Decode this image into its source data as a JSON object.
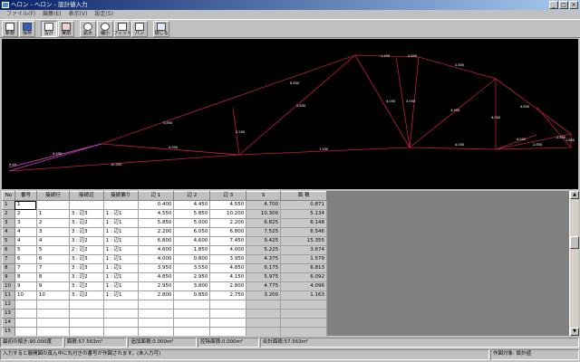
{
  "window": {
    "title": "ヘロン - ヘロン - 設計値入力",
    "min_label": "_",
    "max_label": "□",
    "close_label": "×"
  },
  "menu": [
    "ファイル(F)",
    "編集(E)",
    "表示(V)",
    "設定(S)"
  ],
  "toolbar": [
    {
      "label": "新規",
      "icon": "new-file-icon"
    },
    {
      "label": "保存",
      "icon": "save-icon"
    },
    {
      "label": "設計",
      "icon": "design-icon",
      "pressed": true
    },
    {
      "label": "実測",
      "icon": "measure-icon"
    },
    {
      "label": "拡大",
      "icon": "zoom-in-icon"
    },
    {
      "label": "縮小",
      "icon": "zoom-out-icon"
    },
    {
      "label": "フィット",
      "icon": "fit-icon"
    },
    {
      "label": "パン",
      "icon": "pan-icon"
    },
    {
      "label": "閉じる",
      "icon": "close-window-icon"
    }
  ],
  "drawing": {
    "edge_labels": [
      "1.450",
      "0.850",
      "2.800",
      "6.850",
      "4.050",
      "3.550",
      "5.850",
      "3.950",
      "5.850",
      "4.000",
      "2.200",
      "4.850",
      "4.000",
      "2.850",
      "7.450",
      "10.200",
      "4.950",
      "4.000",
      "2.800",
      "1.850",
      "0.40",
      "4.550"
    ]
  },
  "grid": {
    "headers": [
      "No",
      "番号",
      "接続行",
      "接続辺",
      "接続偏り",
      "辺 1",
      "辺 2",
      "辺 3",
      "S",
      "面 積"
    ],
    "rows": [
      [
        "1",
        "1",
        "",
        "",
        "",
        "0.400",
        "4.450",
        "4.550",
        "4.700",
        "0.871"
      ],
      [
        "2",
        "2",
        "1",
        "3 : 辺3",
        "1 : 辺1",
        "4.550",
        "5.850",
        "10.200",
        "10.300",
        "5.134"
      ],
      [
        "3",
        "3",
        "2",
        "3 : 辺2",
        "1 : 辺1",
        "5.850",
        "5.000",
        "2.200",
        "6.825",
        "6.148"
      ],
      [
        "4",
        "4",
        "3",
        "3 : 辺3",
        "1 : 辺1",
        "2.200",
        "6.050",
        "6.800",
        "7.525",
        "6.546"
      ],
      [
        "5",
        "4",
        "4",
        "3 : 辺2",
        "1 : 辺1",
        "6.800",
        "4.600",
        "7.450",
        "9.425",
        "15.355"
      ],
      [
        "6",
        "5",
        "5",
        "2 : 辺2",
        "1 : 辺1",
        "4.600",
        "1.850",
        "4.000",
        "5.225",
        "3.674"
      ],
      [
        "7",
        "6",
        "6",
        "3 : 辺3",
        "1 : 辺1",
        "4.000",
        "0.800",
        "3.950",
        "4.375",
        "1.579"
      ],
      [
        "8",
        "7",
        "7",
        "3 : 辺3",
        "1 : 辺1",
        "3.950",
        "3.550",
        "4.850",
        "6.175",
        "6.813"
      ],
      [
        "9",
        "8",
        "8",
        "3 : 辺2",
        "1 : 辺1",
        "4.850",
        "2.950",
        "4.150",
        "5.975",
        "6.092"
      ],
      [
        "10",
        "9",
        "9",
        "3 : 辺2",
        "1 : 辺1",
        "2.950",
        "3.800",
        "2.800",
        "4.775",
        "4.096"
      ],
      [
        "11",
        "10",
        "10",
        "3 : 辺2",
        "1 : 辺1",
        "2.800",
        "0.850",
        "2.750",
        "3.200",
        "1.163"
      ],
      [
        "12",
        "",
        "",
        "",
        "",
        "",
        "",
        "",
        "",
        ""
      ],
      [
        "13",
        "",
        "",
        "",
        "",
        "",
        "",
        "",
        "",
        ""
      ],
      [
        "14",
        "",
        "",
        "",
        "",
        "",
        "",
        "",
        "",
        ""
      ],
      [
        "15",
        "",
        "",
        "",
        "",
        "",
        "",
        "",
        "",
        ""
      ]
    ]
  },
  "status": {
    "angle": "最初の傾き:90.000度",
    "area": "面積:57.563m²",
    "added_area": "追加面積:0.000m²",
    "deducted_area": "控除面積:0.000m²",
    "total_area": "合計面積:57.563m²",
    "message": "入力すると展開図の真ん中に丸付きの番号が作図されます。(未入力可)",
    "target": "作図対象:   設計値"
  }
}
